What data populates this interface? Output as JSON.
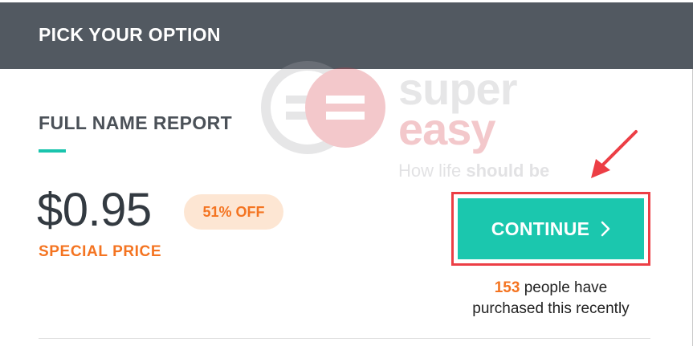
{
  "header": {
    "title": "PICK YOUR OPTION"
  },
  "watermark": {
    "logo_line1": "super",
    "logo_line2": "easy",
    "tagline_plain": "How life ",
    "tagline_bold": "should be"
  },
  "report": {
    "title": "FULL NAME REPORT",
    "price": "$0.95",
    "discount": "51% OFF",
    "price_label": "SPECIAL PRICE"
  },
  "cta": {
    "label": "CONTINUE",
    "icon": "chevron-right-icon",
    "purchase_count": "153",
    "purchase_text_1": " people have",
    "purchase_text_2": "purchased this recently"
  },
  "colors": {
    "header_bg": "#525961",
    "accent_teal": "#1bc7ae",
    "accent_orange": "#f47421",
    "badge_bg": "#fde6d3",
    "highlight_red": "#ec3e45"
  }
}
